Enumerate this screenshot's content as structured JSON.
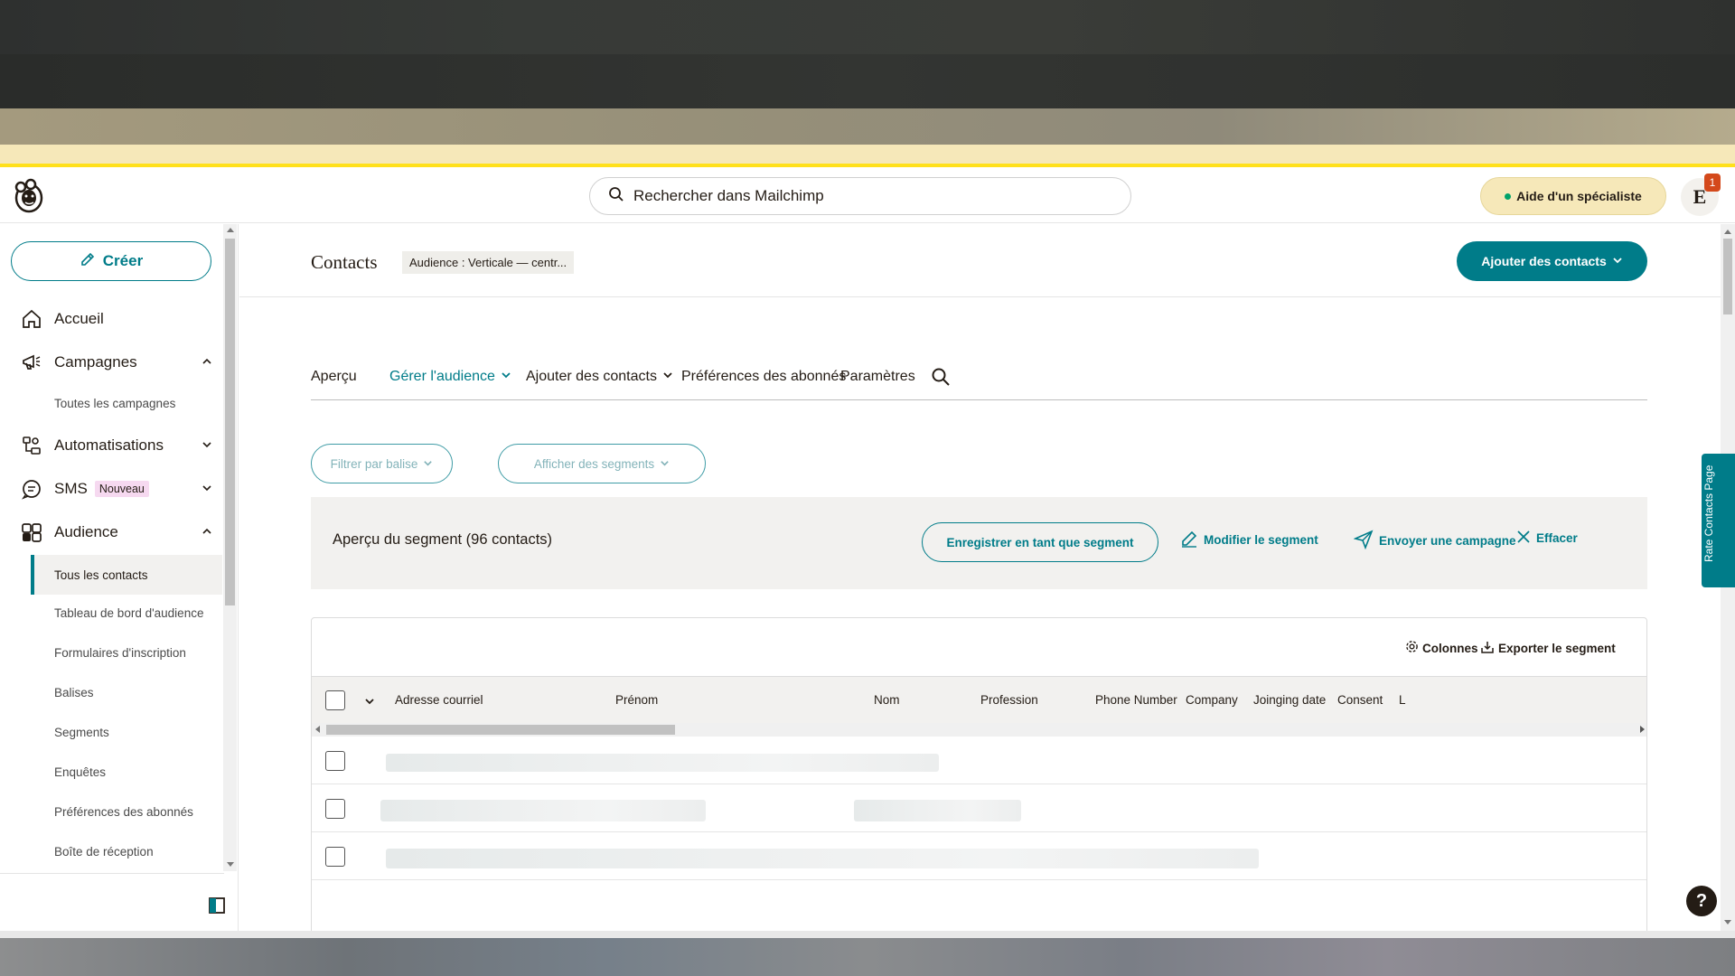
{
  "header": {
    "search_placeholder": "Rechercher dans Mailchimp",
    "help_label": "Aide d'un spécialiste",
    "avatar_initial": "E",
    "notification_count": "1"
  },
  "sidebar": {
    "create_label": "Créer",
    "items": [
      {
        "label": "Accueil",
        "icon": "home-icon"
      },
      {
        "label": "Campagnes",
        "icon": "megaphone-icon",
        "expanded": true
      },
      {
        "label": "Automatisations",
        "icon": "automation-icon",
        "expanded": false
      },
      {
        "label": "SMS",
        "icon": "sms-icon",
        "badge": "Nouveau",
        "expanded": false
      },
      {
        "label": "Audience",
        "icon": "audience-icon",
        "expanded": true
      }
    ],
    "campaign_sub": [
      "Toutes les campagnes"
    ],
    "audience_sub": [
      "Tous les contacts",
      "Tableau de bord d'audience",
      "Formulaires d'inscription",
      "Balises",
      "Segments",
      "Enquêtes",
      "Préférences des abonnés",
      "Boîte de réception"
    ],
    "active_sub": "Tous les contacts"
  },
  "page": {
    "title": "Contacts",
    "audience_chip": "Audience : Verticale — centr...",
    "add_contacts_label": "Ajouter des contacts"
  },
  "tabs": [
    {
      "label": "Aperçu",
      "active": false,
      "dropdown": false
    },
    {
      "label": "Gérer l'audience",
      "active": true,
      "dropdown": true
    },
    {
      "label": "Ajouter des contacts",
      "active": false,
      "dropdown": true
    },
    {
      "label": "Préférences des abonnés",
      "active": false,
      "dropdown": false
    },
    {
      "label": "Paramètres",
      "active": false,
      "dropdown": false
    }
  ],
  "filters": {
    "tag_filter_label": "Filtrer par balise",
    "segments_label": "Afficher des segments"
  },
  "segment": {
    "title": "Aperçu du segment (96 contacts)",
    "save_label": "Enregistrer en tant que segment",
    "edit_label": "Modifier le segment",
    "send_label": "Envoyer une campagne",
    "clear_label": "Effacer"
  },
  "table": {
    "columns_label": "Colonnes",
    "export_label": "Exporter le segment",
    "headers": [
      "Adresse courriel",
      "Prénom",
      "Nom",
      "Profession",
      "Phone Number",
      "Company",
      "Joinging date",
      "Consent",
      "L"
    ],
    "visible_rows": 3
  },
  "feedback_tab": "Rate Contacts Page",
  "help_fab": "?",
  "colors": {
    "accent": "#007c89",
    "yellow": "#ffe01b",
    "help_bg": "#f6e8b9",
    "badge": "#f6d9f0"
  }
}
